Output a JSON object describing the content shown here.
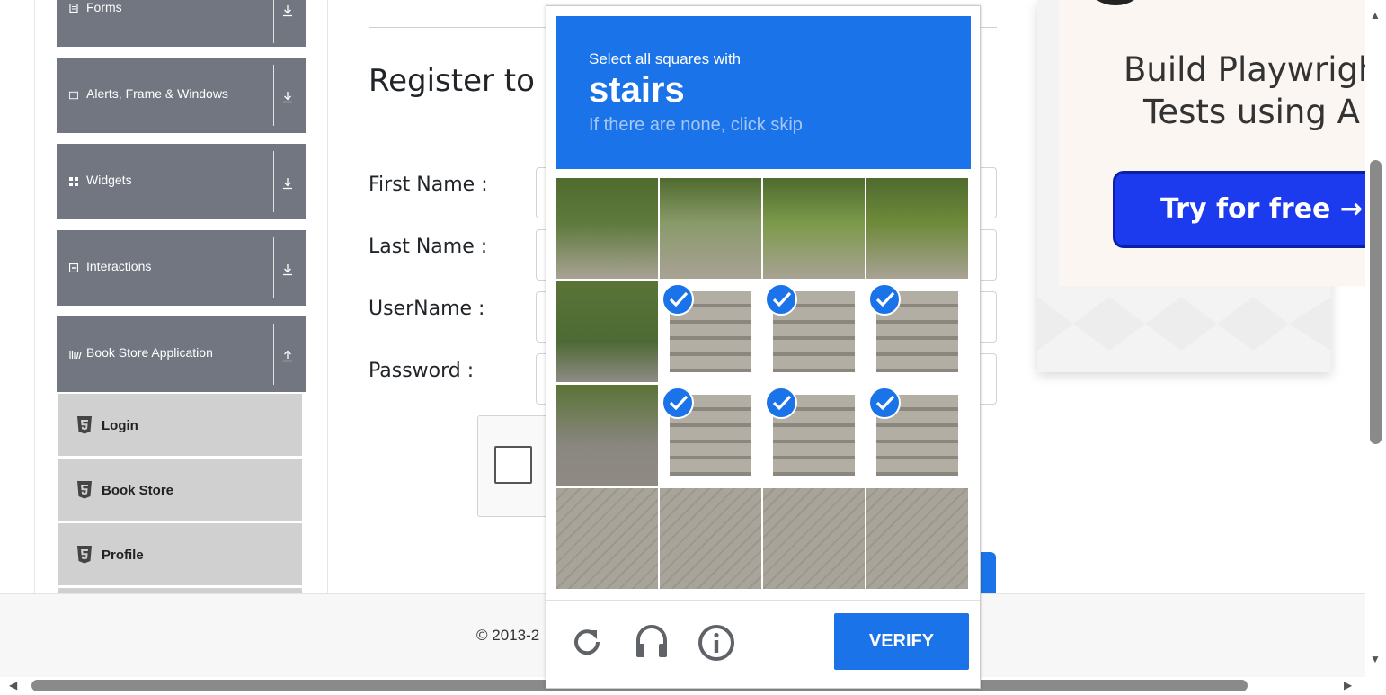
{
  "sidebar": {
    "groups": [
      {
        "label": "Forms",
        "icon": "forms-icon",
        "arrow": "download-arrow"
      },
      {
        "label": "Alerts, Frame & Windows",
        "icon": "window-icon",
        "arrow": "download-arrow"
      },
      {
        "label": "Widgets",
        "icon": "widgets-icon",
        "arrow": "download-arrow"
      },
      {
        "label": "Interactions",
        "icon": "interactions-icon",
        "arrow": "download-arrow"
      },
      {
        "label": "Book Store Application",
        "icon": "library-icon",
        "arrow": "upload-arrow"
      }
    ],
    "sub_items": [
      {
        "label": "Login",
        "icon": "html5-icon"
      },
      {
        "label": "Book Store",
        "icon": "html5-icon"
      },
      {
        "label": "Profile",
        "icon": "html5-icon"
      }
    ]
  },
  "form": {
    "title": "Register to B",
    "labels": {
      "first_name": "First Name :",
      "last_name": "Last Name :",
      "username": "UserName :",
      "password": "Password :"
    }
  },
  "footer": {
    "copyright": "© 2013-2"
  },
  "ad": {
    "title_line1": "Build Playwrigh",
    "title_line2": "Tests using A",
    "button": "Try for free →"
  },
  "captcha": {
    "instruction": "Select all squares with",
    "target": "stairs",
    "hint": "If there are none, click skip",
    "verify_label": "VERIFY",
    "icons": [
      "reload-icon",
      "audio-icon",
      "info-icon"
    ],
    "grid": [
      [
        false,
        false,
        false,
        false
      ],
      [
        false,
        true,
        true,
        true
      ],
      [
        false,
        true,
        true,
        true
      ],
      [
        false,
        false,
        false,
        false
      ]
    ],
    "colors": {
      "accent": "#1a73e8"
    }
  }
}
